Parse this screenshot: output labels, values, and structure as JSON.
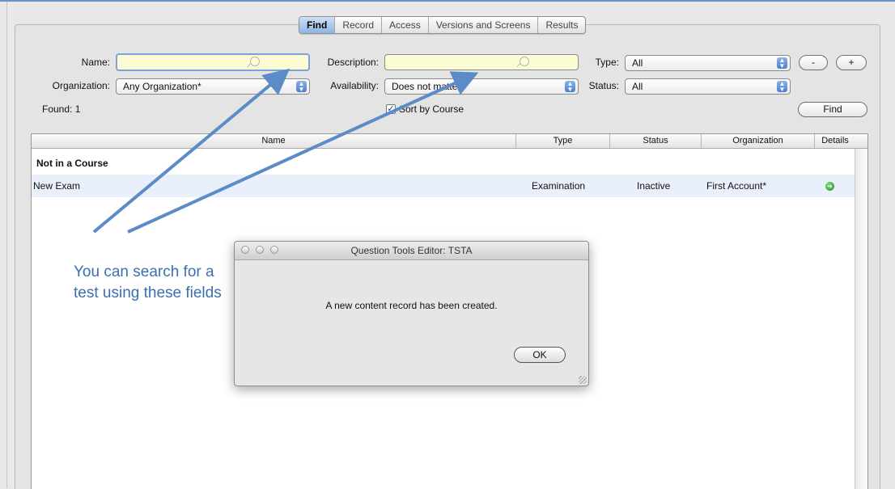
{
  "tabs": [
    "Find",
    "Record",
    "Access",
    "Versions and Screens",
    "Results"
  ],
  "active_tab": "Find",
  "form": {
    "name_label": "Name:",
    "name_value": "",
    "description_label": "Description:",
    "description_value": "",
    "type_label": "Type:",
    "type_value": "All",
    "organization_label": "Organization:",
    "organization_value": "Any Organization*",
    "availability_label": "Availability:",
    "availability_value": "Does not matter",
    "status_label": "Status:",
    "status_value": "All",
    "found_text": "Found: 1",
    "sort_label": "Sort by Course",
    "sort_checked": true,
    "minus_label": "-",
    "plus_label": "+",
    "find_button": "Find"
  },
  "table": {
    "columns": [
      "Name",
      "Type",
      "Status",
      "Organization",
      "Details"
    ],
    "group_label": "Not in a Course",
    "rows": [
      {
        "name": "New Exam",
        "type": "Examination",
        "status": "Inactive",
        "organization": "First Account*"
      }
    ]
  },
  "dialog": {
    "title": "Question Tools Editor: TSTA",
    "message": "A new content record has been created.",
    "ok_label": "OK"
  },
  "annotation": {
    "text": "You can search for a test using these fields"
  },
  "colors": {
    "field_yellow": "#fbfbd4",
    "selection_blue": "#8fb3e3",
    "row_highlight": "#eaf0fb",
    "annotation_blue": "#3b6fb0",
    "arrow_blue": "#5b8cc8"
  },
  "icons": {
    "search": "magnifier-icon",
    "details": "green-arrow-icon"
  }
}
